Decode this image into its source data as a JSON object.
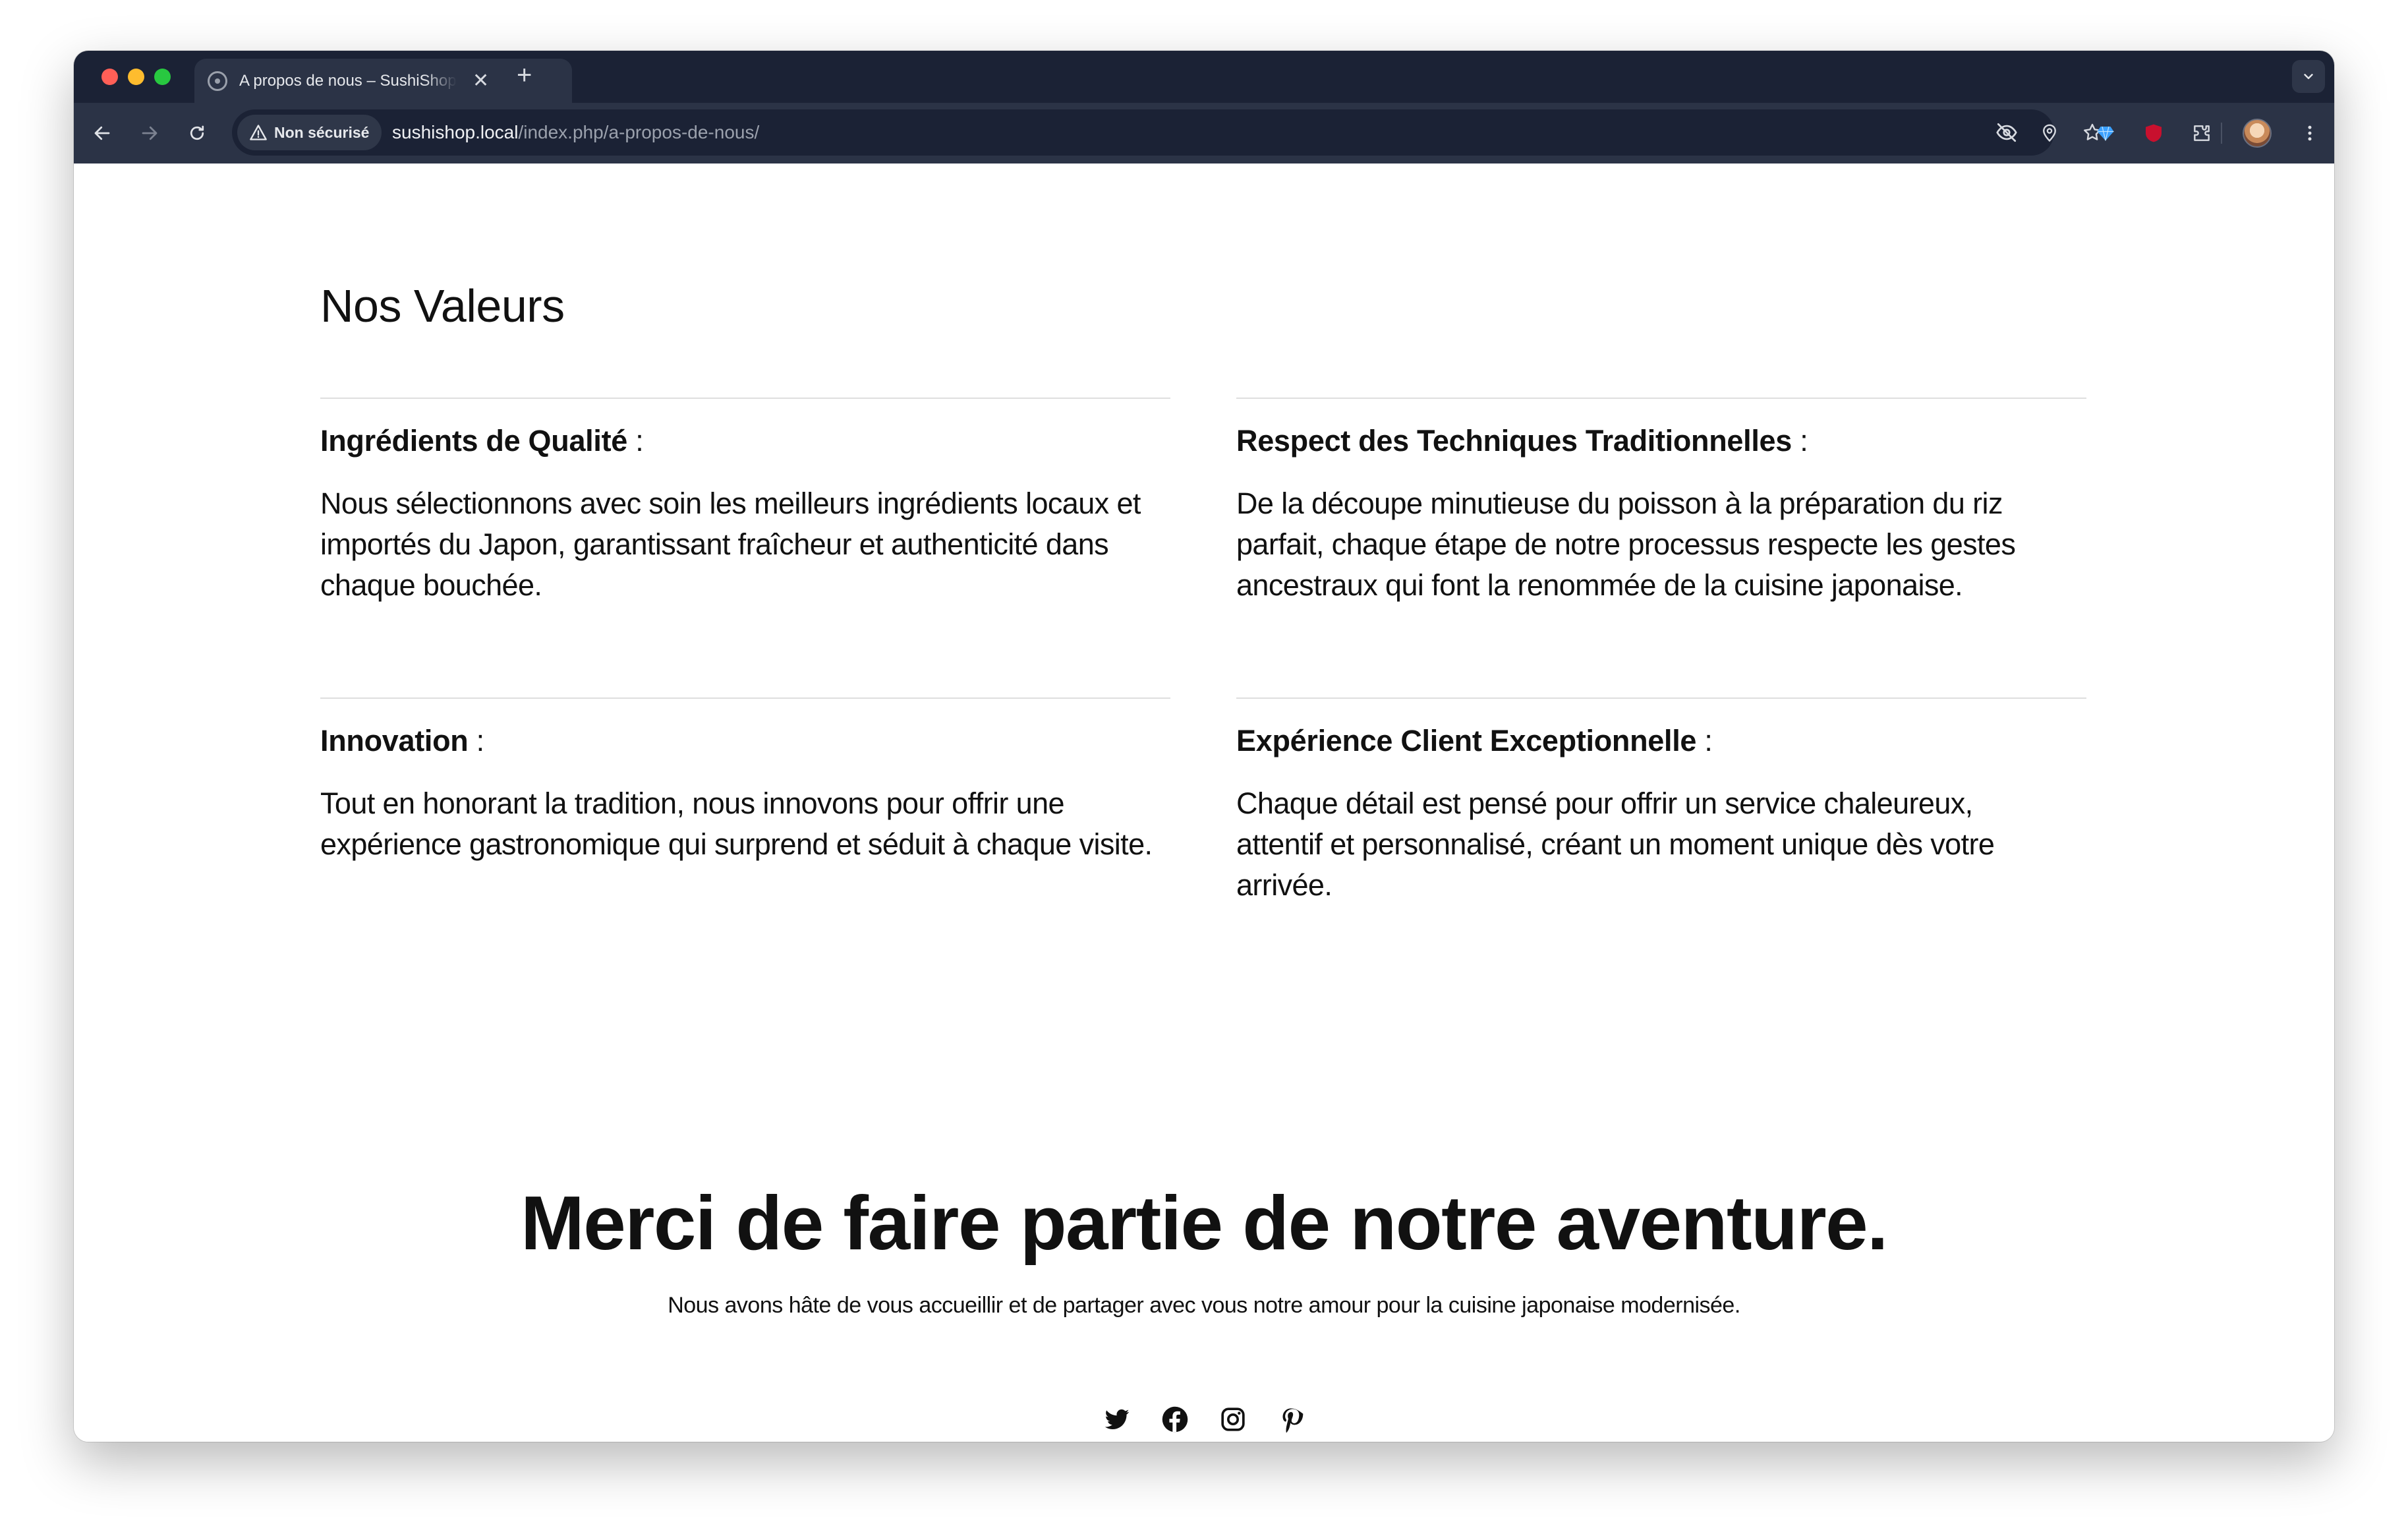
{
  "browser": {
    "tab": {
      "title": "A propos de nous – SushiShop",
      "close_symbol": "✕"
    },
    "new_tab_symbol": "+",
    "security_label": "Non sécurisé",
    "url": {
      "host": "sushishop.local",
      "path": "/index.php/a-propos-de-nous/"
    },
    "icons": [
      "back-icon",
      "forward-icon",
      "reload-icon",
      "warning-icon",
      "eye-off-icon",
      "location-pin-icon",
      "bookmark-star-icon",
      "gem-extension-icon",
      "ublock-extension-icon",
      "extensions-puzzle-icon",
      "profile-avatar",
      "more-menu-icon",
      "tab-list-chevron-icon"
    ],
    "ublock_badge": "uO"
  },
  "page": {
    "values_title": "Nos Valeurs",
    "values": [
      {
        "title": "Ingrédients de Qualité",
        "colon": " :",
        "text": "Nous sélectionnons avec soin les meilleurs ingrédients locaux et importés du Japon, garantissant fraîcheur et authenticité dans chaque bouchée."
      },
      {
        "title": "Respect des Techniques Traditionnelles",
        "colon": " :",
        "text": "De la découpe minutieuse du poisson à la préparation du riz parfait, chaque étape de notre processus respecte les gestes ancestraux qui font la renommée de la cuisine japonaise."
      },
      {
        "title": "Innovation",
        "colon": " :",
        "text": "Tout en honorant la tradition, nous innovons pour offrir une expérience gastronomique qui surprend et séduit à chaque visite."
      },
      {
        "title": "Expérience Client Exceptionnelle",
        "colon": " :",
        "text": "Chaque détail est pensé pour offrir un service chaleureux, attentif et personnalisé, créant un moment unique dès votre arrivée."
      }
    ],
    "thanks_title": "Merci de faire partie de notre aventure.",
    "thanks_text": "Nous avons hâte de vous accueillir et de partager avec vous notre amour pour la cuisine japonaise modernisée.",
    "social_icons": [
      "twitter-icon",
      "facebook-icon",
      "instagram-icon",
      "pinterest-icon"
    ]
  },
  "colors": {
    "chrome_dark": "#1b2235",
    "chrome_toolbar": "#2b3346",
    "text": "#111111",
    "divider": "#dedede"
  }
}
